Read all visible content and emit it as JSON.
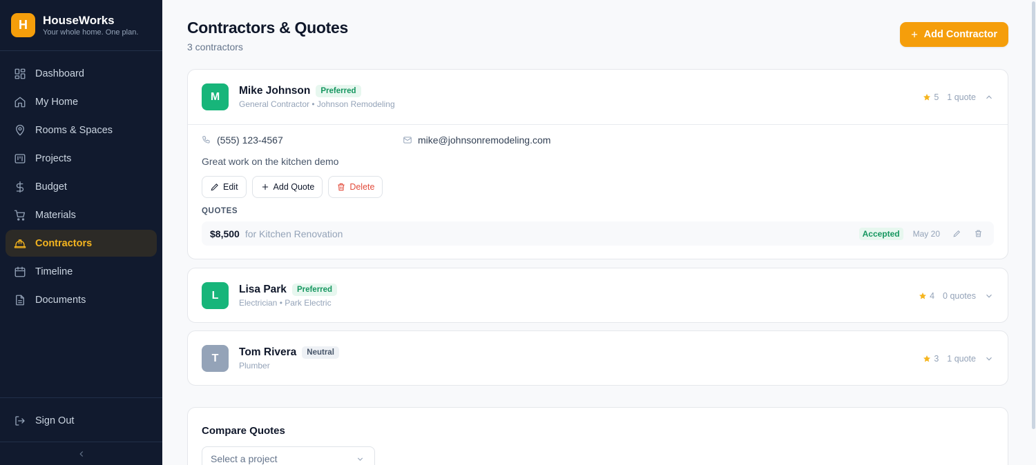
{
  "brand": {
    "logo_letter": "H",
    "name": "HouseWorks",
    "tagline": "Your whole home. One plan."
  },
  "nav": [
    {
      "label": "Dashboard",
      "icon": "grid-icon"
    },
    {
      "label": "My Home",
      "icon": "home-icon"
    },
    {
      "label": "Rooms & Spaces",
      "icon": "map-pin-icon"
    },
    {
      "label": "Projects",
      "icon": "kanban-icon"
    },
    {
      "label": "Budget",
      "icon": "dollar-icon"
    },
    {
      "label": "Materials",
      "icon": "cart-icon"
    },
    {
      "label": "Contractors",
      "icon": "hard-hat-icon",
      "active": true
    },
    {
      "label": "Timeline",
      "icon": "calendar-icon"
    },
    {
      "label": "Documents",
      "icon": "document-icon"
    }
  ],
  "sidebar_footer": {
    "signout_label": "Sign Out"
  },
  "header": {
    "title": "Contractors & Quotes",
    "subtitle": "3 contractors",
    "add_label": "Add Contractor"
  },
  "contractors": [
    {
      "initial": "M",
      "name": "Mike Johnson",
      "badge": "Preferred",
      "subtitle": "General Contractor • Johnson Remodeling",
      "rating": "5",
      "quote_count": "1 quote",
      "avatar_color": "#17b57a",
      "phone": "(555) 123-4567",
      "email": "mike@johnsonremodeling.com",
      "notes": "Great work on the kitchen demo",
      "actions": {
        "edit": "Edit",
        "add_quote": "Add Quote",
        "delete": "Delete"
      },
      "quotes_label": "QUOTES",
      "quotes": [
        {
          "amount": "$8,500",
          "for": "for Kitchen Renovation",
          "status": "Accepted",
          "date": "May 20"
        }
      ]
    },
    {
      "initial": "L",
      "name": "Lisa Park",
      "badge": "Preferred",
      "subtitle": "Electrician • Park Electric",
      "rating": "4",
      "quote_count": "0 quotes",
      "avatar_color": "#17b57a"
    },
    {
      "initial": "T",
      "name": "Tom Rivera",
      "badge": "Neutral",
      "subtitle": "Plumber",
      "rating": "3",
      "quote_count": "1 quote",
      "avatar_color": "#94a3b8"
    }
  ],
  "compare": {
    "title": "Compare Quotes",
    "select_placeholder": "Select a project"
  },
  "colors": {
    "accent": "#f59e0b",
    "sidebar_bg": "#111a2e",
    "preferred": "#15965f",
    "danger": "#e24b3b"
  }
}
